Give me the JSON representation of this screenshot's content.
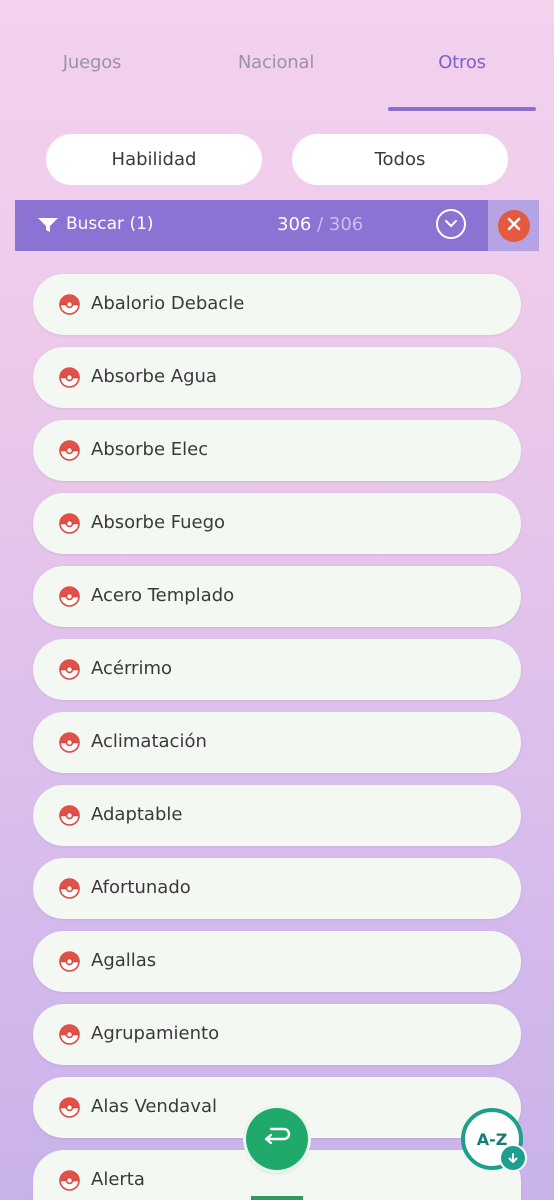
{
  "tabs": [
    {
      "label": "Juegos",
      "active": false
    },
    {
      "label": "Nacional",
      "active": false
    },
    {
      "label": "Otros",
      "active": true
    }
  ],
  "filters": {
    "category": "Habilidad",
    "scope": "Todos"
  },
  "search": {
    "label": "Buscar (1)",
    "count_shown": "306",
    "count_total": " / 306"
  },
  "abilities": [
    "Abalorio Debacle",
    "Absorbe Agua",
    "Absorbe Elec",
    "Absorbe Fuego",
    "Acero Templado",
    "Acérrimo",
    "Aclimatación",
    "Adaptable",
    "Afortunado",
    "Agallas",
    "Agrupamiento",
    "Alas Vendaval",
    "Alerta"
  ],
  "sort_button": {
    "label": "A-Z"
  },
  "icons": {
    "filter": "funnel-icon",
    "expand": "chevron-down-icon",
    "clear": "close-icon",
    "item": "pokeball-icon",
    "back": "return-arrow-icon",
    "sort": "sort-az-icon"
  },
  "colors": {
    "accent": "#8b72d3",
    "clear": "#e55a3e",
    "fab_green": "#1fa96b",
    "sort_teal": "#1e9e8e"
  }
}
